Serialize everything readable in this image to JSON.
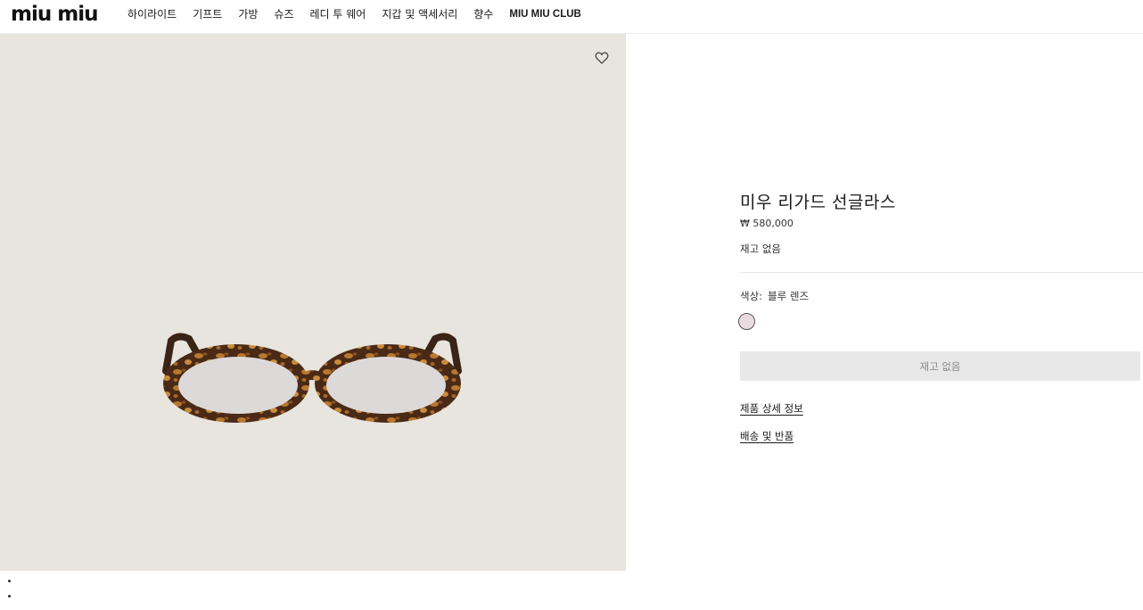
{
  "header": {
    "logo": "miu miu",
    "nav": [
      "하이라이트",
      "기프트",
      "가방",
      "슈즈",
      "레디 투 웨어",
      "지갑 및 액세서리",
      "향수",
      "MIU MIU CLUB"
    ]
  },
  "product": {
    "title": "미우 리가드 선글라스",
    "price": "₩ 580,000",
    "stock_status": "재고 없음",
    "color_label": "색상:",
    "color_value": "블루 렌즈",
    "swatch_color": "#e9dbe0",
    "button_label": "재고 없음",
    "links": [
      "제품 상세 정보",
      "배송 및 반품"
    ]
  },
  "image": {
    "background": "#e8e4de",
    "wishlist_icon": "heart-icon",
    "carousel_dots": 2
  }
}
